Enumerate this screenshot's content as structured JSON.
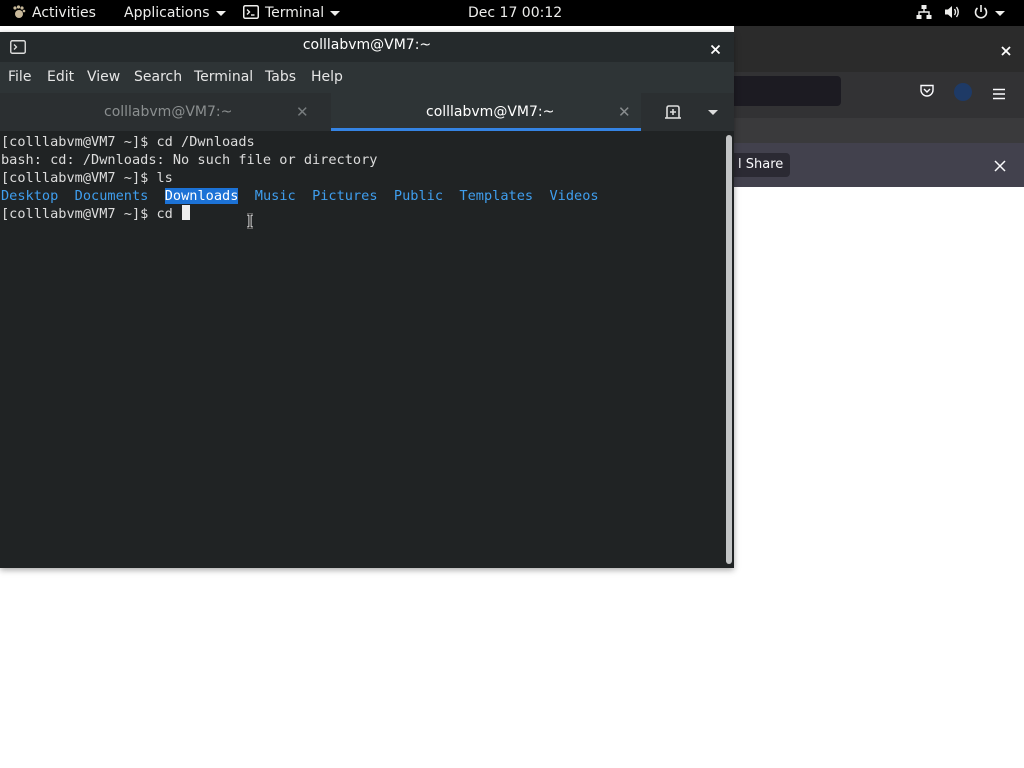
{
  "topbar": {
    "activities": "Activities",
    "applications": "Applications",
    "app_name": "Terminal",
    "datetime": "Dec 17  00:12"
  },
  "terminal": {
    "title": "colllabvm@VM7:~",
    "menu": [
      "File",
      "Edit",
      "View",
      "Search",
      "Terminal",
      "Tabs",
      "Help"
    ],
    "tabs": [
      {
        "label": "colllabvm@VM7:~",
        "active": false
      },
      {
        "label": "colllabvm@VM7:~",
        "active": true
      }
    ],
    "lines": {
      "l1": "[colllabvm@VM7 ~]$ cd /Dwnloads",
      "l2": "bash: cd: /Dwnloads: No such file or directory",
      "l3": "[colllabvm@VM7 ~]$ ls",
      "l5": "[colllabvm@VM7 ~]$ cd "
    },
    "ls_dirs": [
      "Desktop",
      "Documents",
      "Downloads",
      "Music",
      "Pictures",
      "Public",
      "Templates",
      "Videos"
    ],
    "selected_dir": "Downloads"
  },
  "firefox": {
    "share_label": "l Share"
  },
  "colors": {
    "terminal_bg": "#202324",
    "dir_blue": "#3f9eee",
    "selection": "#1c72d6",
    "tab_accent": "#3584e4"
  }
}
